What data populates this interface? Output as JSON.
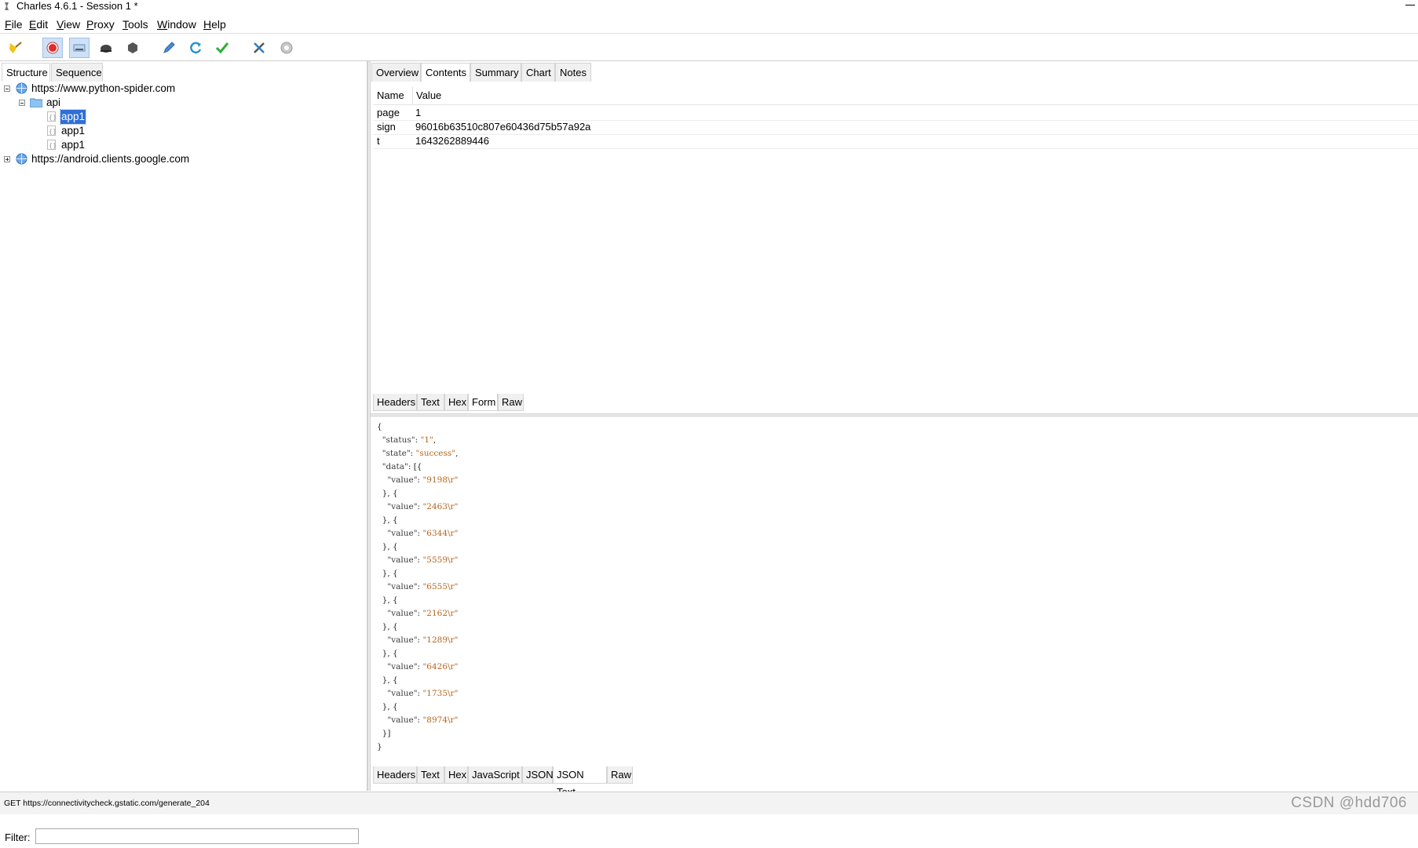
{
  "window": {
    "title": "Charles 4.6.1 - Session 1 *"
  },
  "menubar": [
    {
      "mn": "F",
      "rest": "ile"
    },
    {
      "mn": "E",
      "rest": "dit"
    },
    {
      "mn": "V",
      "rest": "iew"
    },
    {
      "mn": "P",
      "rest": "roxy"
    },
    {
      "mn": "T",
      "rest": "ools"
    },
    {
      "mn": "W",
      "rest": "indow"
    },
    {
      "mn": "H",
      "rest": "elp"
    }
  ],
  "toolbar": {
    "icons": [
      "broom-icon",
      "record-icon",
      "throttle-icon",
      "turtle-icon",
      "hexagon-stop-icon",
      "pen-icon",
      "refresh-icon",
      "checkmark-icon",
      "tools-icon",
      "settings-gear-icon"
    ]
  },
  "left_tabs": [
    "Structure",
    "Sequence"
  ],
  "tree": {
    "host1": "https://www.python-spider.com",
    "folder": "api",
    "items": [
      "app1",
      "app1",
      "app1"
    ],
    "host2": "https://android.clients.google.com"
  },
  "filter": {
    "label": "Filter:",
    "value": ""
  },
  "right_tabs": [
    "Overview",
    "Contents",
    "Summary",
    "Chart",
    "Notes"
  ],
  "form_table": {
    "headers": [
      "Name",
      "Value"
    ],
    "rows": [
      {
        "name": "page",
        "value": "1"
      },
      {
        "name": "sign",
        "value": "96016b63510c807e60436d75b57a92a"
      },
      {
        "name": "t",
        "value": "1643262889446"
      }
    ]
  },
  "request_tabs": [
    "Headers",
    "Text",
    "Hex",
    "Form",
    "Raw"
  ],
  "json_response": {
    "status": "1",
    "state": "success",
    "values": [
      "9198\\r",
      "2463\\r",
      "6344\\r",
      "5559\\r",
      "6555\\r",
      "2162\\r",
      "1289\\r",
      "6426\\r",
      "1735\\r",
      "8974\\r"
    ]
  },
  "response_tabs": [
    "Headers",
    "Text",
    "Hex",
    "JavaScript",
    "JSON",
    "JSON Text",
    "Raw"
  ],
  "statusbar": {
    "text": "GET https://connectivitycheck.gstatic.com/generate_204"
  },
  "watermark": "CSDN @hdd706"
}
